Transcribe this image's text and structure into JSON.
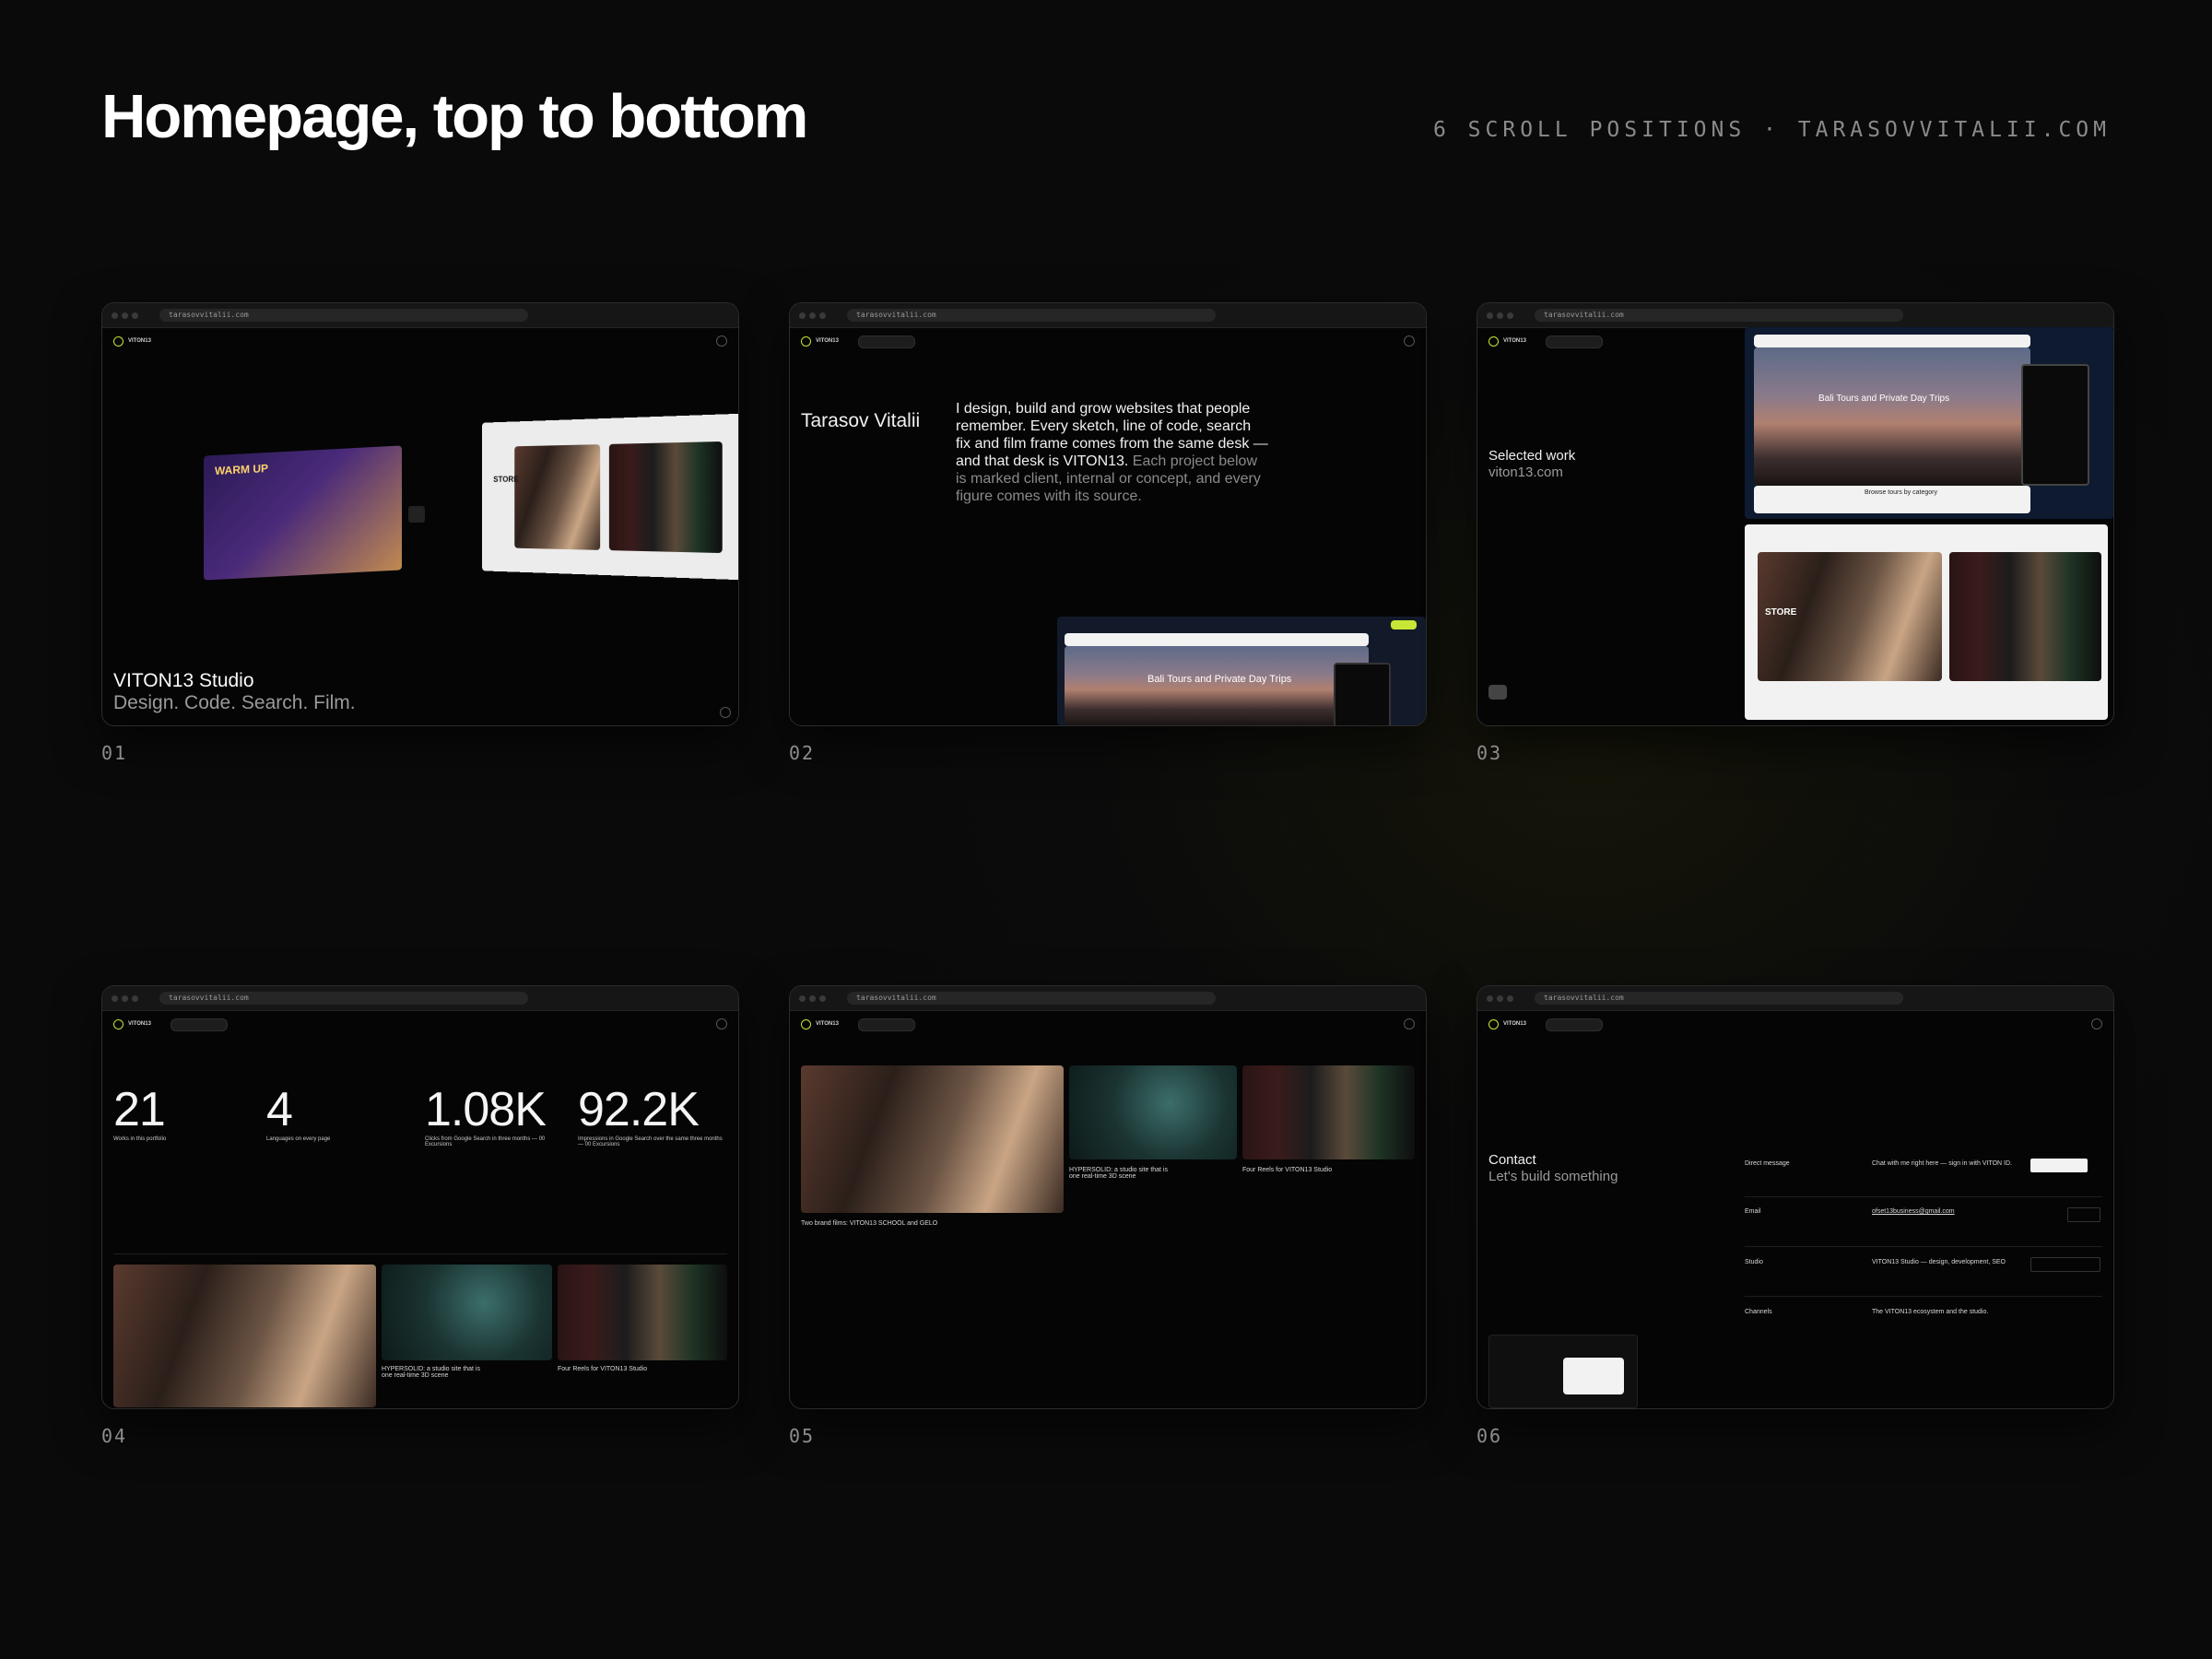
{
  "header": {
    "title": "Homepage, top to bottom",
    "meta": "6 SCROLL POSITIONS · TARASOVVITALII.COM"
  },
  "browser": {
    "url": "tarasovvitalii.com"
  },
  "tiles": [
    {
      "number": "01",
      "nav_brand": "VITON13",
      "title": "VITON13 Studio",
      "subtitle": "Design. Code. Search. Film.",
      "mock_label_warmup": "WARM UP",
      "mock_label_store": "STORE"
    },
    {
      "number": "02",
      "nav_brand": "VITON13",
      "name": "Tarasov Vitalii",
      "intro_lead": "I design, build and grow websites that people remember. Every sketch, line of code, search fix and film frame comes from the same desk — and that desk is VITON13.",
      "intro_rest": " Each project below is marked client, internal or concept, and every figure comes with its source.",
      "preview_title": "Bali Tours and Private Day Trips"
    },
    {
      "number": "03",
      "nav_brand": "VITON13",
      "label": "Selected work",
      "site": "viton13.com",
      "preview_title": "Bali Tours and Private Day Trips",
      "preview_sub": "Browse tours by category",
      "store_label": "STORE"
    },
    {
      "number": "04",
      "nav_brand": "VITON13",
      "stats": [
        {
          "value": "21",
          "label": "Works in this portfolio"
        },
        {
          "value": "4",
          "label": "Languages on every page"
        },
        {
          "value": "1.08K",
          "label": "Clicks from Google Search in three months — 00 Excursions"
        },
        {
          "value": "92.2K",
          "label": "Impressions in Google Search over the same three months — 00 Excursions"
        }
      ],
      "cards": [
        {
          "caption": ""
        },
        {
          "caption": "HYPERSOLID: a studio site that is one real-time 3D scene"
        },
        {
          "caption": "Four Reels for VITON13 Studio"
        }
      ]
    },
    {
      "number": "05",
      "nav_brand": "VITON13",
      "cards": [
        {
          "caption": "Two brand films: VITON13 SCHOOL and GELO"
        },
        {
          "caption": "HYPERSOLID: a studio site that is one real-time 3D scene"
        },
        {
          "caption": "Four Reels for VITON13 Studio"
        }
      ]
    },
    {
      "number": "06",
      "nav_brand": "VITON13",
      "title": "Contact",
      "subtitle": "Let's build something",
      "rows": [
        {
          "label": "Direct message",
          "value": "Chat with me right here — sign in with VITON ID."
        },
        {
          "label": "Email",
          "value": "ofset13business@gmail.com"
        },
        {
          "label": "Studio",
          "value": "VITON13 Studio — design, development, SEO"
        },
        {
          "label": "Channels",
          "value": "The VITON13 ecosystem and the studio."
        }
      ]
    }
  ]
}
